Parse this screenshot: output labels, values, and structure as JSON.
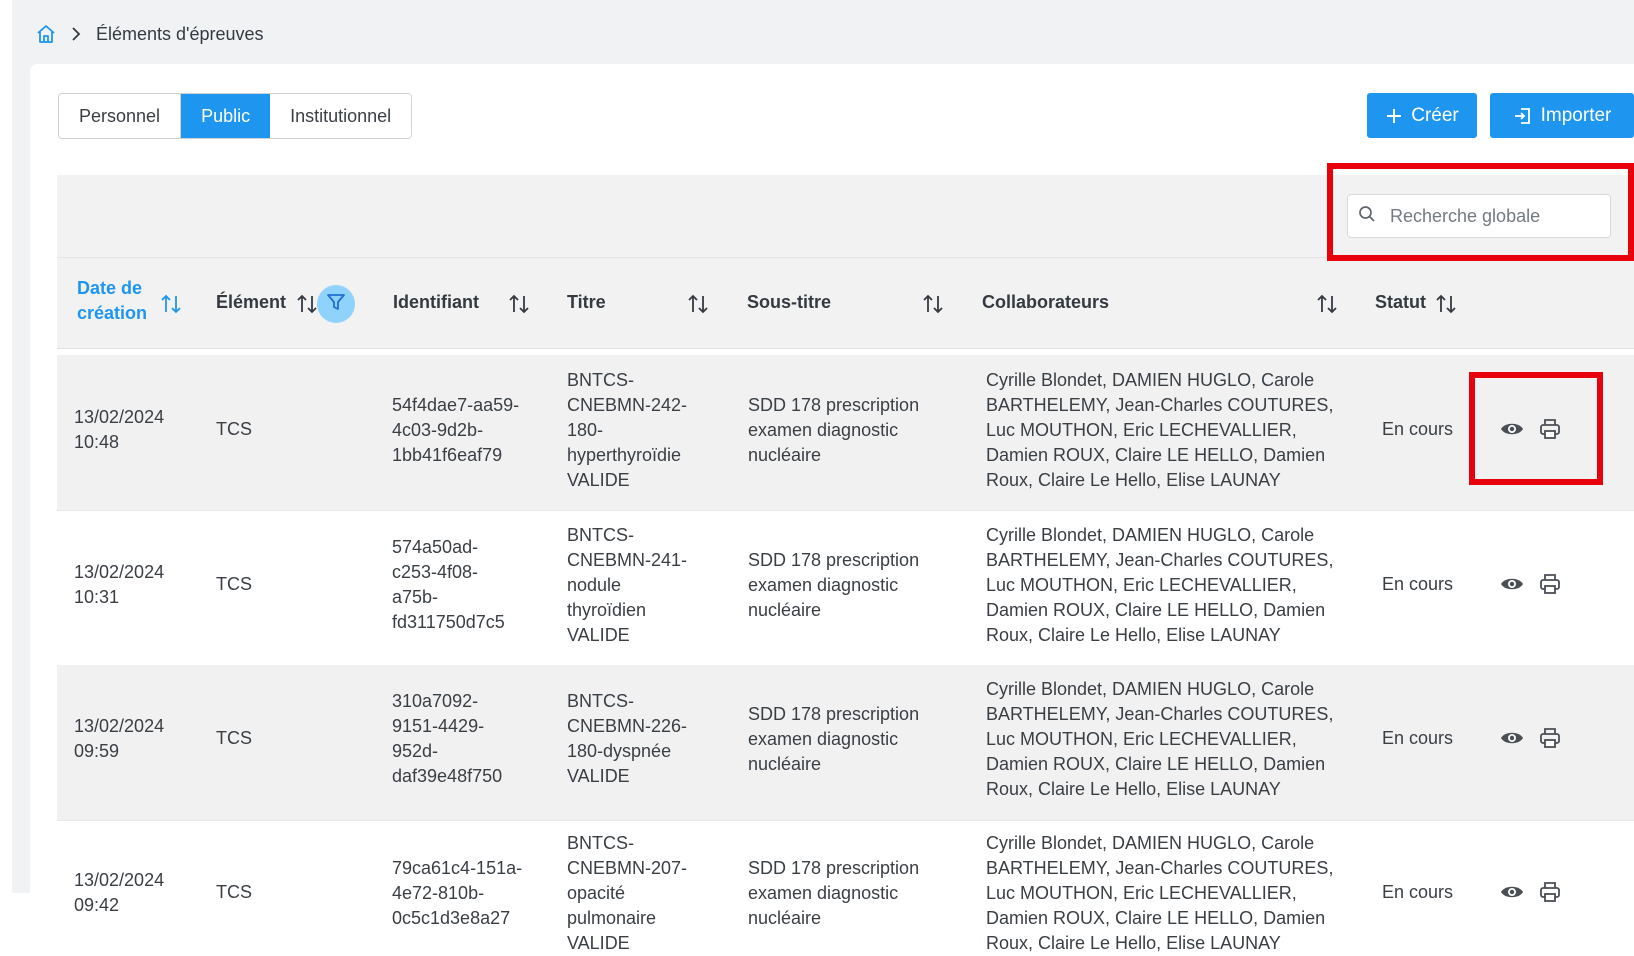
{
  "breadcrumb": {
    "current": "Éléments d'épreuves"
  },
  "tabs": [
    "Personnel",
    "Public",
    "Institutionnel"
  ],
  "active_tab": "Public",
  "buttons": {
    "create": "Créer",
    "import": "Importer"
  },
  "search": {
    "placeholder": "Recherche globale"
  },
  "columns": {
    "date": [
      "Date de",
      "création"
    ],
    "element": "Élément",
    "identifiant": "Identifiant",
    "titre": "Titre",
    "sous_titre": "Sous-titre",
    "collaborateurs": "Collaborateurs",
    "statut": "Statut"
  },
  "rows": [
    {
      "date": [
        "13/02/2024",
        "10:48"
      ],
      "element": "TCS",
      "identifiant": [
        "54f4dae7-aa59-",
        "4c03-9d2b-",
        "1bb41f6eaf79"
      ],
      "titre": [
        "BNTCS-",
        "CNEBMN-242-",
        "180-",
        "hyperthyroïdie",
        "VALIDE"
      ],
      "sous_titre": [
        "SDD 178 prescription",
        "examen diagnostic",
        "nucléaire"
      ],
      "collaborateurs": [
        "Cyrille Blondet, DAMIEN HUGLO, Carole",
        "BARTHELEMY, Jean-Charles COUTURES,",
        "Luc MOUTHON, Eric LECHEVALLIER,",
        "Damien ROUX, Claire LE HELLO, Damien",
        "Roux, Claire Le Hello, Elise LAUNAY"
      ],
      "statut": "En cours"
    },
    {
      "date": [
        "13/02/2024",
        "10:31"
      ],
      "element": "TCS",
      "identifiant": [
        "574a50ad-",
        "c253-4f08-",
        "a75b-",
        "fd311750d7c5"
      ],
      "titre": [
        "BNTCS-",
        "CNEBMN-241-",
        "nodule",
        "thyroïdien",
        "VALIDE"
      ],
      "sous_titre": [
        "SDD 178 prescription",
        "examen diagnostic",
        "nucléaire"
      ],
      "collaborateurs": [
        "Cyrille Blondet, DAMIEN HUGLO, Carole",
        "BARTHELEMY, Jean-Charles COUTURES,",
        "Luc MOUTHON, Eric LECHEVALLIER,",
        "Damien ROUX, Claire LE HELLO, Damien",
        "Roux, Claire Le Hello, Elise LAUNAY"
      ],
      "statut": "En cours"
    },
    {
      "date": [
        "13/02/2024",
        "09:59"
      ],
      "element": "TCS",
      "identifiant": [
        "310a7092-",
        "9151-4429-",
        "952d-",
        "daf39e48f750"
      ],
      "titre": [
        "BNTCS-",
        "CNEBMN-226-",
        "180-dyspnée",
        "VALIDE"
      ],
      "sous_titre": [
        "SDD 178 prescription",
        "examen diagnostic",
        "nucléaire"
      ],
      "collaborateurs": [
        "Cyrille Blondet, DAMIEN HUGLO, Carole",
        "BARTHELEMY, Jean-Charles COUTURES,",
        "Luc MOUTHON, Eric LECHEVALLIER,",
        "Damien ROUX, Claire LE HELLO, Damien",
        "Roux, Claire Le Hello, Elise LAUNAY"
      ],
      "statut": "En cours"
    },
    {
      "date": [
        "13/02/2024",
        "09:42"
      ],
      "element": "TCS",
      "identifiant": [
        "79ca61c4-151a-",
        "4e72-810b-",
        "0c5c1d3e8a27"
      ],
      "titre": [
        "BNTCS-",
        "CNEBMN-207-",
        "opacité",
        "pulmonaire",
        "VALIDE"
      ],
      "sous_titre": [
        "SDD 178 prescription",
        "examen diagnostic",
        "nucléaire"
      ],
      "collaborateurs": [
        "Cyrille Blondet, DAMIEN HUGLO, Carole",
        "BARTHELEMY, Jean-Charles COUTURES,",
        "Luc MOUTHON, Eric LECHEVALLIER,",
        "Damien ROUX, Claire LE HELLO, Damien",
        "Roux, Claire Le Hello, Elise LAUNAY"
      ],
      "statut": "En cours"
    }
  ],
  "colors": {
    "primary": "#1e96f0",
    "filter": "#8fd2fb",
    "highlight": "#e8000b"
  },
  "icons": {
    "home": "home-icon",
    "chevron": "chevron-right-icon",
    "plus": "plus-icon",
    "import": "import-icon",
    "search": "search-icon",
    "sort": "sort-icon",
    "filter": "filter-icon",
    "view": "eye-icon",
    "print": "printer-icon"
  }
}
